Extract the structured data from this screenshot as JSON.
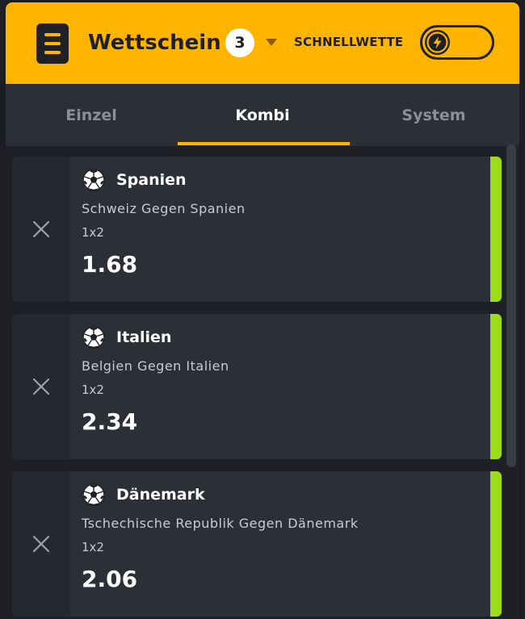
{
  "header": {
    "title": "Wettschein",
    "count": "3",
    "quick_bet_label": "SCHNELLWETTE",
    "icons": {
      "menu": "menu-icon",
      "dropdown": "chevron-down-icon",
      "lightning": "lightning-icon"
    }
  },
  "tabs": [
    {
      "label": "Einzel",
      "active": false
    },
    {
      "label": "Kombi",
      "active": true
    },
    {
      "label": "System",
      "active": false
    }
  ],
  "bets": [
    {
      "team": "Spanien",
      "match": "Schweiz Gegen Spanien",
      "market": "1x2",
      "odds": "1.68"
    },
    {
      "team": "Italien",
      "match": "Belgien Gegen Italien",
      "market": "1x2",
      "odds": "2.34"
    },
    {
      "team": "Dänemark",
      "match": "Tschechische Republik Gegen Dänemark",
      "market": "1x2",
      "odds": "2.06"
    }
  ],
  "colors": {
    "accent": "#ffb400",
    "status_bar": "#9cdd1a",
    "card_bg": "#2c2f36"
  }
}
